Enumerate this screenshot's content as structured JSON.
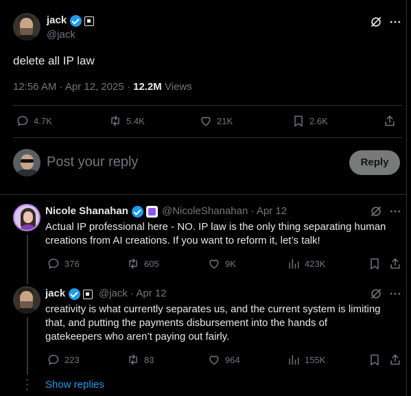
{
  "main_tweet": {
    "author_name": "jack",
    "author_handle": "@jack",
    "text": "delete all IP law",
    "time": "12:56 AM · Apr 12, 2025 · ",
    "views_count": "12.2M",
    "views_label": " Views",
    "stats": {
      "replies": "4.7K",
      "reposts": "5.4K",
      "likes": "21K",
      "bookmarks": "2.6K"
    }
  },
  "composer": {
    "placeholder": "Post your reply",
    "button_label": "Reply"
  },
  "replies": [
    {
      "author_name": "Nicole Shanahan",
      "handle_time": "@NicoleShanahan · Apr 12",
      "lines": [
        "Actual IP professional here - NO. IP law is the only thing separating human",
        "creations from AI creations. If you want to reform it, let’s talk!"
      ],
      "stats": {
        "replies": "376",
        "reposts": "605",
        "likes": "9K",
        "views": "423K"
      }
    },
    {
      "author_name": "jack",
      "handle_time": "@jack · Apr 12",
      "lines": [
        "creativity is what currently separates us, and the current system is limiting",
        "that, and putting the payments disbursement into the hands of",
        "gatekeepers who aren’t paying out fairly."
      ],
      "stats": {
        "replies": "223",
        "reposts": "83",
        "likes": "964",
        "views": "155K"
      }
    }
  ],
  "show_replies_label": "Show replies",
  "colors": {
    "background": "#000000",
    "text": "#e7e9ea",
    "muted": "#71767b",
    "accent": "#1d9bf0",
    "divider": "#2f3336"
  },
  "icons": [
    "verified-icon",
    "affiliate-icon",
    "grok-icon",
    "more-icon",
    "reply-icon",
    "repost-icon",
    "like-icon",
    "bookmark-icon",
    "share-icon",
    "views-icon"
  ]
}
